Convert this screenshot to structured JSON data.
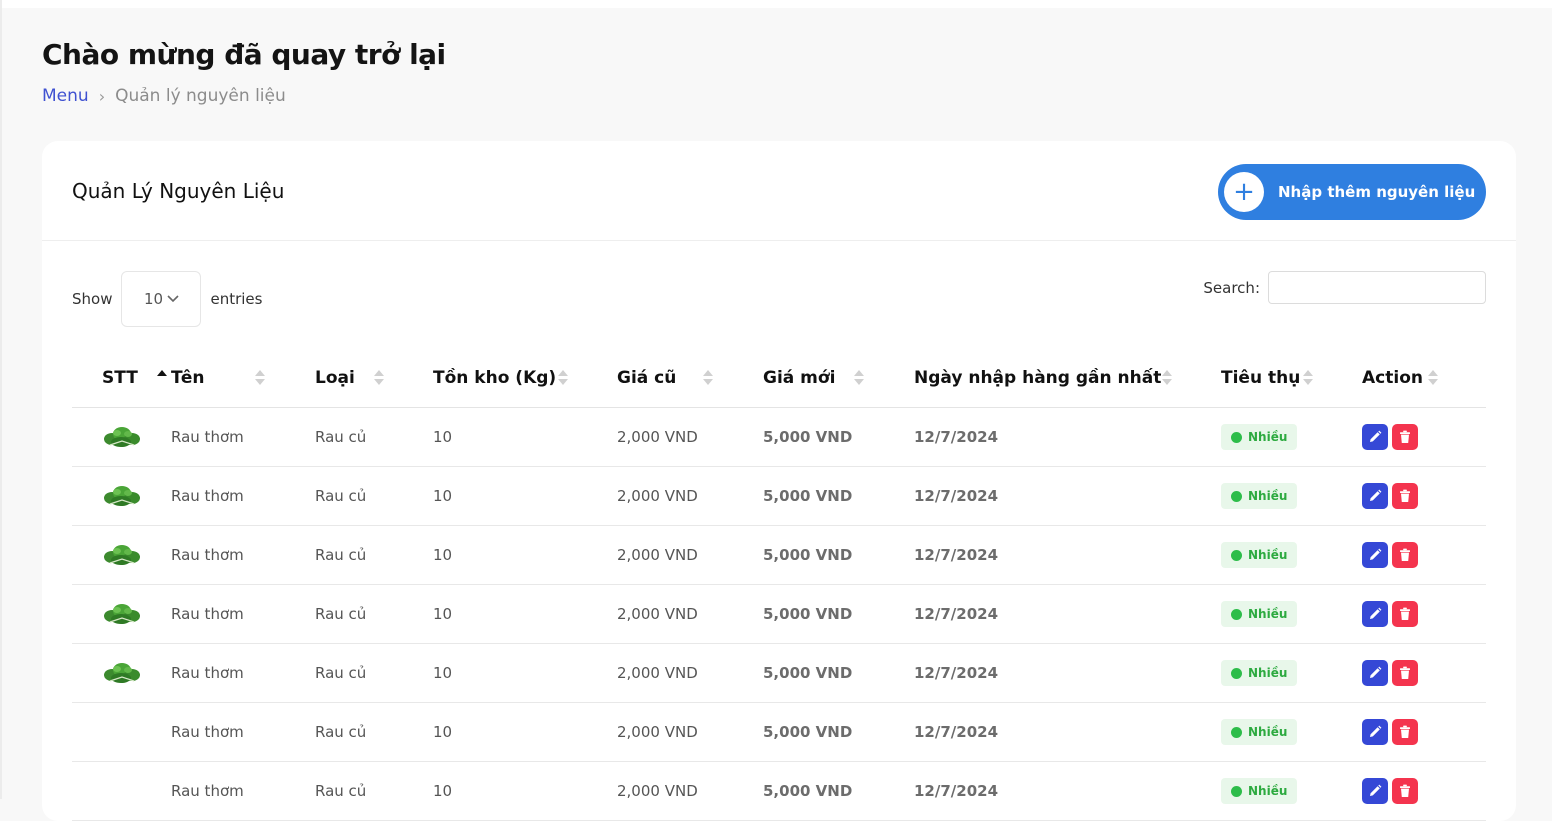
{
  "header": {
    "greeting": "Chào mừng đã quay trở lại",
    "breadcrumb": {
      "root": "Menu",
      "current": "Quản lý nguyên liệu"
    }
  },
  "card": {
    "title": "Quản Lý Nguyên Liệu",
    "add_button": "Nhập thêm nguyên liệu"
  },
  "controls": {
    "show_label": "Show",
    "entries_value": "10",
    "entries_label": "entries",
    "search_label": "Search:",
    "search_value": ""
  },
  "table": {
    "columns": [
      "STT",
      "Tên",
      "Loại",
      "Tồn kho (Kg)",
      "Giá cũ",
      "Giá mới",
      "Ngày nhập hàng gần nhất",
      "Tiêu thụ",
      "Action"
    ],
    "sorted_column": "STT",
    "rows": [
      {
        "name": "Rau thơm",
        "type": "Rau củ",
        "stock": "10",
        "old_price": "2,000 VND",
        "new_price": "5,000 VND",
        "date": "12/7/2024",
        "usage": "Nhiều",
        "has_image": true
      },
      {
        "name": "Rau thơm",
        "type": "Rau củ",
        "stock": "10",
        "old_price": "2,000 VND",
        "new_price": "5,000 VND",
        "date": "12/7/2024",
        "usage": "Nhiều",
        "has_image": true
      },
      {
        "name": "Rau thơm",
        "type": "Rau củ",
        "stock": "10",
        "old_price": "2,000 VND",
        "new_price": "5,000 VND",
        "date": "12/7/2024",
        "usage": "Nhiều",
        "has_image": true
      },
      {
        "name": "Rau thơm",
        "type": "Rau củ",
        "stock": "10",
        "old_price": "2,000 VND",
        "new_price": "5,000 VND",
        "date": "12/7/2024",
        "usage": "Nhiều",
        "has_image": true
      },
      {
        "name": "Rau thơm",
        "type": "Rau củ",
        "stock": "10",
        "old_price": "2,000 VND",
        "new_price": "5,000 VND",
        "date": "12/7/2024",
        "usage": "Nhiều",
        "has_image": true
      },
      {
        "name": "Rau thơm",
        "type": "Rau củ",
        "stock": "10",
        "old_price": "2,000 VND",
        "new_price": "5,000 VND",
        "date": "12/7/2024",
        "usage": "Nhiều",
        "has_image": false
      },
      {
        "name": "Rau thơm",
        "type": "Rau củ",
        "stock": "10",
        "old_price": "2,000 VND",
        "new_price": "5,000 VND",
        "date": "12/7/2024",
        "usage": "Nhiều",
        "has_image": false
      }
    ]
  },
  "colors": {
    "accent": "#2f7fe0",
    "link": "#3f51d1",
    "edit": "#3548d6",
    "delete": "#f4344e",
    "usage_badge": "#2daa40"
  },
  "icons": {
    "add": "plus-icon",
    "dropdown": "chevron-down-icon",
    "row_image": "herb-leaf-icon",
    "edit": "pencil-icon",
    "delete": "trash-icon"
  }
}
